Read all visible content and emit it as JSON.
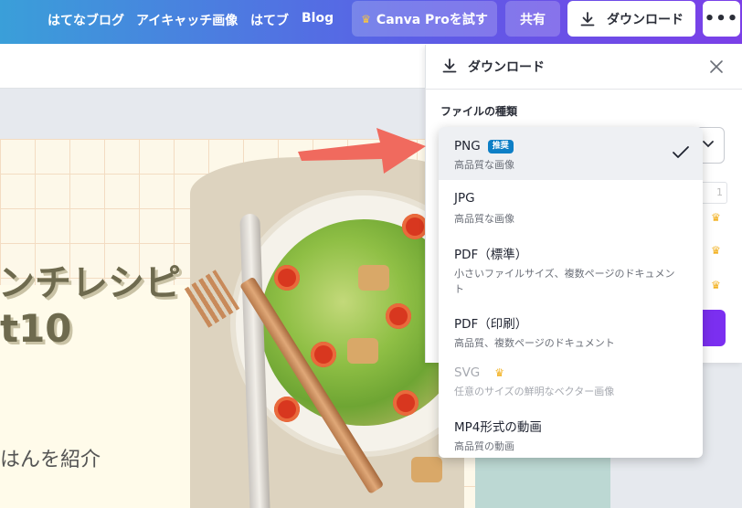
{
  "topbar": {
    "links": [
      "はてなブログ",
      "アイキャッチ画像",
      "はてブ",
      "Blog"
    ],
    "pro_button": "Canva Proを試す",
    "share_button": "共有",
    "download_button": "ダウンロード",
    "more_button": "•••"
  },
  "design": {
    "headline_1": "ンチレシピ",
    "headline_2": "t10",
    "subline": "はんを紹介"
  },
  "panel": {
    "title": "ダウンロード",
    "file_type_label": "ファイルの種類",
    "ghost_value": "1"
  },
  "dropdown": {
    "options": [
      {
        "name": "PNG",
        "badge": "推奨",
        "desc": "高品質な画像",
        "selected": true,
        "pro": false
      },
      {
        "name": "JPG",
        "desc": "高品質な画像"
      },
      {
        "name": "PDF（標準）",
        "desc": "小さいファイルサイズ、複数ページのドキュメント"
      },
      {
        "name": "PDF（印刷）",
        "desc": "高品質、複数ページのドキュメント"
      },
      {
        "name": "SVG",
        "desc": "任意のサイズの鮮明なベクター画像",
        "disabled": true,
        "pro": true
      },
      {
        "name": "MP4形式の動画",
        "desc": "高品質の動画"
      }
    ]
  },
  "colors": {
    "accent_purple": "#7b2ff0",
    "badge_blue": "#0d7fc6",
    "crown_gold": "#f2b01e",
    "arrow_red": "#f06a5e"
  },
  "icons": [
    "crown-icon",
    "download-icon",
    "close-icon",
    "chevron-down-icon",
    "checkmark-icon",
    "arrow-icon"
  ]
}
